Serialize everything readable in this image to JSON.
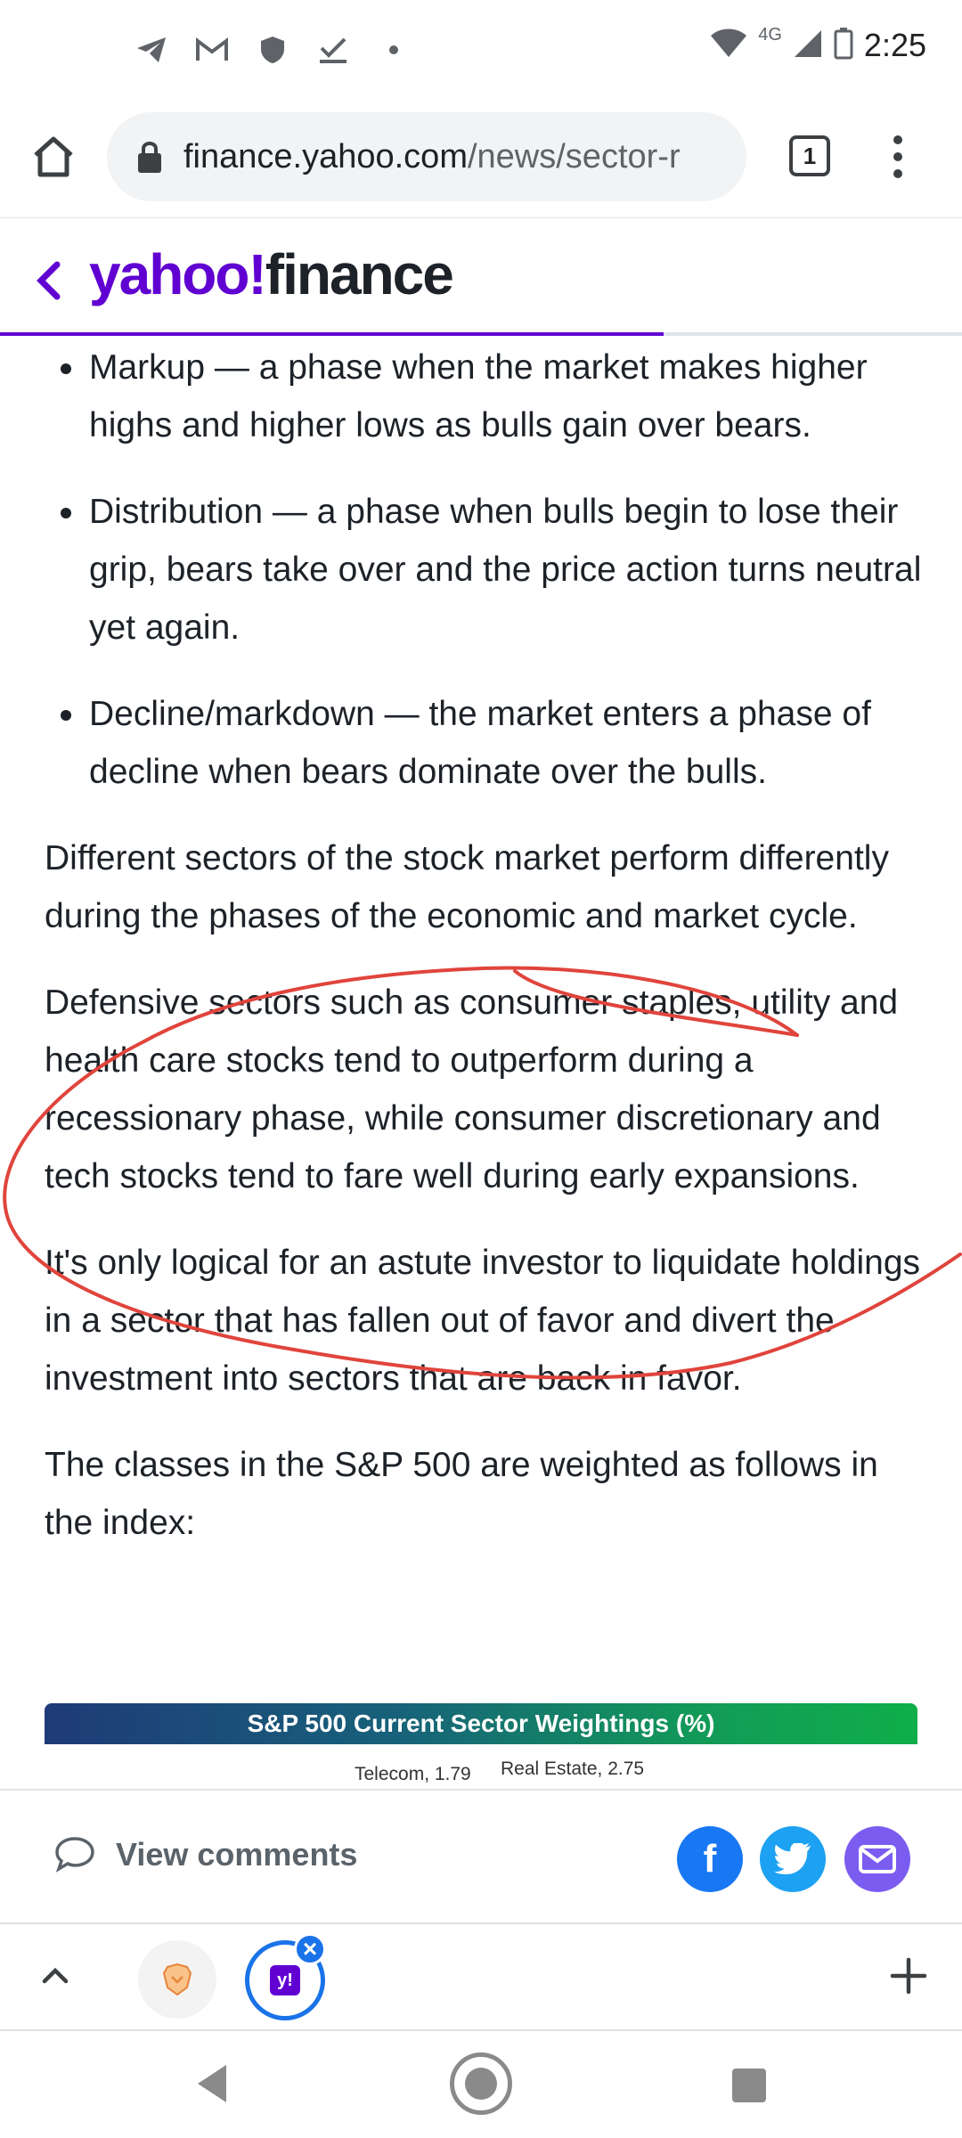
{
  "status_bar": {
    "time": "2:25",
    "network": "4G",
    "left_icons": [
      "telegram-icon",
      "gmail-icon",
      "shield-icon",
      "check-icon",
      "dot-icon"
    ],
    "right_icons": [
      "wifi-icon",
      "signal-icon",
      "battery-icon"
    ]
  },
  "browser": {
    "url_host": "finance.yahoo.com",
    "url_path": "/news/sector-r",
    "tab_count": "1"
  },
  "site": {
    "logo_yahoo": "yahoo!",
    "logo_finance": "finance",
    "brand_color": "#6001d2",
    "read_progress": 0.69
  },
  "article": {
    "bullets": [
      "Markup — a phase when the market makes higher highs and higher lows as bulls gain over bears.",
      "Distribution — a phase when bulls begin to lose their grip, bears take over and the price action turns neutral yet again.",
      "Decline/markdown — the market enters a phase of decline when bears dominate over the bulls."
    ],
    "paragraphs": [
      "Different sectors of the stock market perform differently during the phases of the economic and market cycle.",
      "Defensive sectors such as consumer staples, utility and health care stocks tend to outperform during a recessionary phase, while consumer discretionary and tech stocks tend to fare well during early expansions.",
      "It's only logical for an astute investor to liquidate holdings in a sector that has fallen out of favor and divert the investment into sectors that are back in favor.",
      "The classes in the S&P 500 are weighted as follows in the index:"
    ],
    "chart_title": "S&P 500 Current Sector Weightings (%)",
    "chart_peek_labels": [
      "Telecom, 1.79",
      "Real Estate, 2.75"
    ],
    "annotation_color": "#e0443c"
  },
  "comments": {
    "label": "View comments"
  },
  "share": {
    "facebook_glyph": "f",
    "twitter_glyph": "🐦"
  }
}
